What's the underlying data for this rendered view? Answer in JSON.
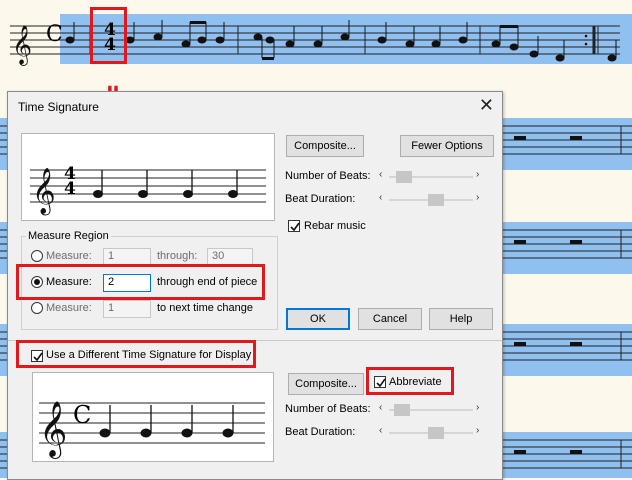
{
  "dialog": {
    "title": "Time Signature",
    "close_glyph": "✕",
    "composite_label": "Composite...",
    "fewer_options_label": "Fewer Options",
    "number_of_beats_label": "Number of Beats:",
    "beat_duration_label": "Beat Duration:",
    "rebar_label": "Rebar music",
    "rebar_checked": true,
    "measure_region": {
      "group_label": "Measure Region",
      "row1": {
        "label": "Measure:",
        "value": "1",
        "through_label": "through:",
        "through_value": "30",
        "selected": false
      },
      "row2": {
        "label": "Measure:",
        "value": "2",
        "suffix": "through end of piece",
        "selected": true
      },
      "row3": {
        "label": "Measure:",
        "value": "1",
        "suffix": "to next time change",
        "selected": false
      }
    },
    "ok_label": "OK",
    "cancel_label": "Cancel",
    "help_label": "Help",
    "display_section": {
      "use_different_label": "Use a Different Time Signature for Display",
      "use_different_checked": true,
      "composite_label": "Composite...",
      "abbreviate_label": "Abbreviate",
      "abbreviate_checked": true,
      "number_of_beats_label": "Number of Beats:",
      "beat_duration_label": "Beat Duration:"
    },
    "preview_top": {
      "time_sig_top": "4",
      "time_sig_bottom": "4"
    },
    "preview_bottom": {
      "time_sig": "C"
    }
  },
  "score": {
    "time_sig": "C",
    "meter_top": "4",
    "meter_bottom": "4"
  },
  "annotation": {
    "arrow_glyph": "⇓"
  },
  "colors": {
    "highlight": "#8fc0f0",
    "paper": "#fdf8ec",
    "annotation_red": "#e0191f",
    "accent": "#0078d7"
  }
}
